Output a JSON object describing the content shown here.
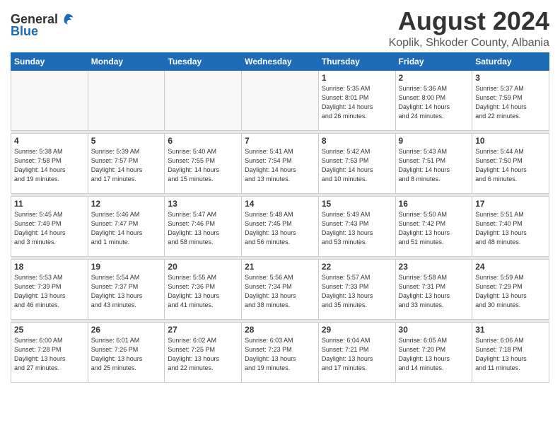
{
  "logo": {
    "general": "General",
    "blue": "Blue"
  },
  "title": {
    "month_year": "August 2024",
    "location": "Koplik, Shkoder County, Albania"
  },
  "days_header": [
    "Sunday",
    "Monday",
    "Tuesday",
    "Wednesday",
    "Thursday",
    "Friday",
    "Saturday"
  ],
  "weeks": [
    [
      {
        "day": "",
        "info": ""
      },
      {
        "day": "",
        "info": ""
      },
      {
        "day": "",
        "info": ""
      },
      {
        "day": "",
        "info": ""
      },
      {
        "day": "1",
        "info": "Sunrise: 5:35 AM\nSunset: 8:01 PM\nDaylight: 14 hours\nand 26 minutes."
      },
      {
        "day": "2",
        "info": "Sunrise: 5:36 AM\nSunset: 8:00 PM\nDaylight: 14 hours\nand 24 minutes."
      },
      {
        "day": "3",
        "info": "Sunrise: 5:37 AM\nSunset: 7:59 PM\nDaylight: 14 hours\nand 22 minutes."
      }
    ],
    [
      {
        "day": "4",
        "info": "Sunrise: 5:38 AM\nSunset: 7:58 PM\nDaylight: 14 hours\nand 19 minutes."
      },
      {
        "day": "5",
        "info": "Sunrise: 5:39 AM\nSunset: 7:57 PM\nDaylight: 14 hours\nand 17 minutes."
      },
      {
        "day": "6",
        "info": "Sunrise: 5:40 AM\nSunset: 7:55 PM\nDaylight: 14 hours\nand 15 minutes."
      },
      {
        "day": "7",
        "info": "Sunrise: 5:41 AM\nSunset: 7:54 PM\nDaylight: 14 hours\nand 13 minutes."
      },
      {
        "day": "8",
        "info": "Sunrise: 5:42 AM\nSunset: 7:53 PM\nDaylight: 14 hours\nand 10 minutes."
      },
      {
        "day": "9",
        "info": "Sunrise: 5:43 AM\nSunset: 7:51 PM\nDaylight: 14 hours\nand 8 minutes."
      },
      {
        "day": "10",
        "info": "Sunrise: 5:44 AM\nSunset: 7:50 PM\nDaylight: 14 hours\nand 6 minutes."
      }
    ],
    [
      {
        "day": "11",
        "info": "Sunrise: 5:45 AM\nSunset: 7:49 PM\nDaylight: 14 hours\nand 3 minutes."
      },
      {
        "day": "12",
        "info": "Sunrise: 5:46 AM\nSunset: 7:47 PM\nDaylight: 14 hours\nand 1 minute."
      },
      {
        "day": "13",
        "info": "Sunrise: 5:47 AM\nSunset: 7:46 PM\nDaylight: 13 hours\nand 58 minutes."
      },
      {
        "day": "14",
        "info": "Sunrise: 5:48 AM\nSunset: 7:45 PM\nDaylight: 13 hours\nand 56 minutes."
      },
      {
        "day": "15",
        "info": "Sunrise: 5:49 AM\nSunset: 7:43 PM\nDaylight: 13 hours\nand 53 minutes."
      },
      {
        "day": "16",
        "info": "Sunrise: 5:50 AM\nSunset: 7:42 PM\nDaylight: 13 hours\nand 51 minutes."
      },
      {
        "day": "17",
        "info": "Sunrise: 5:51 AM\nSunset: 7:40 PM\nDaylight: 13 hours\nand 48 minutes."
      }
    ],
    [
      {
        "day": "18",
        "info": "Sunrise: 5:53 AM\nSunset: 7:39 PM\nDaylight: 13 hours\nand 46 minutes."
      },
      {
        "day": "19",
        "info": "Sunrise: 5:54 AM\nSunset: 7:37 PM\nDaylight: 13 hours\nand 43 minutes."
      },
      {
        "day": "20",
        "info": "Sunrise: 5:55 AM\nSunset: 7:36 PM\nDaylight: 13 hours\nand 41 minutes."
      },
      {
        "day": "21",
        "info": "Sunrise: 5:56 AM\nSunset: 7:34 PM\nDaylight: 13 hours\nand 38 minutes."
      },
      {
        "day": "22",
        "info": "Sunrise: 5:57 AM\nSunset: 7:33 PM\nDaylight: 13 hours\nand 35 minutes."
      },
      {
        "day": "23",
        "info": "Sunrise: 5:58 AM\nSunset: 7:31 PM\nDaylight: 13 hours\nand 33 minutes."
      },
      {
        "day": "24",
        "info": "Sunrise: 5:59 AM\nSunset: 7:29 PM\nDaylight: 13 hours\nand 30 minutes."
      }
    ],
    [
      {
        "day": "25",
        "info": "Sunrise: 6:00 AM\nSunset: 7:28 PM\nDaylight: 13 hours\nand 27 minutes."
      },
      {
        "day": "26",
        "info": "Sunrise: 6:01 AM\nSunset: 7:26 PM\nDaylight: 13 hours\nand 25 minutes."
      },
      {
        "day": "27",
        "info": "Sunrise: 6:02 AM\nSunset: 7:25 PM\nDaylight: 13 hours\nand 22 minutes."
      },
      {
        "day": "28",
        "info": "Sunrise: 6:03 AM\nSunset: 7:23 PM\nDaylight: 13 hours\nand 19 minutes."
      },
      {
        "day": "29",
        "info": "Sunrise: 6:04 AM\nSunset: 7:21 PM\nDaylight: 13 hours\nand 17 minutes."
      },
      {
        "day": "30",
        "info": "Sunrise: 6:05 AM\nSunset: 7:20 PM\nDaylight: 13 hours\nand 14 minutes."
      },
      {
        "day": "31",
        "info": "Sunrise: 6:06 AM\nSunset: 7:18 PM\nDaylight: 13 hours\nand 11 minutes."
      }
    ]
  ]
}
